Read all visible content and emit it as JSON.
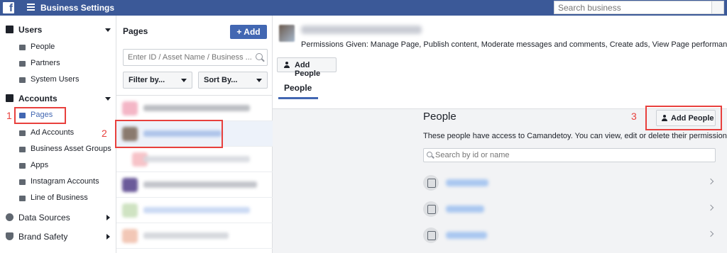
{
  "topbar": {
    "logo": "f",
    "title": "Business Settings",
    "search_placeholder": "Search business"
  },
  "sidebar": {
    "sections": [
      {
        "label": "Users",
        "items": [
          "People",
          "Partners",
          "System Users"
        ]
      },
      {
        "label": "Accounts",
        "items": [
          "Pages",
          "Ad Accounts",
          "Business Asset Groups",
          "Apps",
          "Instagram Accounts",
          "Line of Business"
        ]
      },
      {
        "label": "Data Sources"
      },
      {
        "label": "Brand Safety"
      }
    ],
    "active_item": "Pages"
  },
  "pages_panel": {
    "title": "Pages",
    "add_label": "+ Add",
    "filter_placeholder": "Enter ID / Asset Name / Business ...",
    "filter_by_label": "Filter by...",
    "sort_by_label": "Sort By..."
  },
  "detail": {
    "permissions_text": "Permissions Given: Manage Page, Publish content, Moderate messages and comments, Create ads, View Page performance",
    "add_people_label": "Add People",
    "tab_label": "People",
    "people_title": "People",
    "people_add_label": "Add People",
    "people_description": "These people have access to Camandetoy. You can view, edit or delete their permissions.",
    "people_search_placeholder": "Search by id or name"
  },
  "annotations": {
    "step1": "1",
    "step2": "2",
    "step3": "3"
  },
  "colors": {
    "topbar": "#3b5998",
    "accent": "#4267b2",
    "annotation": "#e8403d"
  }
}
